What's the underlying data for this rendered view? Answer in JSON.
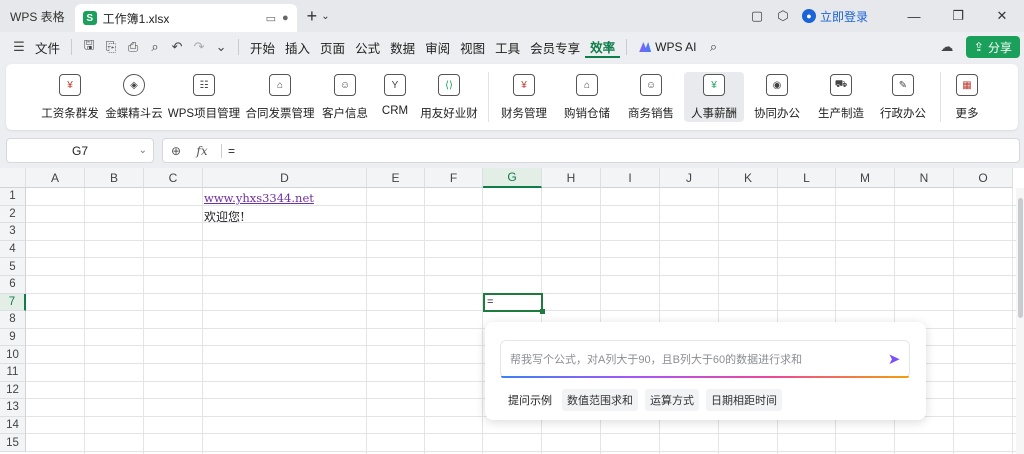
{
  "titlebar": {
    "app_label": "WPS 表格",
    "doc_name": "工作簿1.xlsx",
    "login_label": "立即登录"
  },
  "menu": {
    "file": "文件",
    "tabs": [
      "开始",
      "插入",
      "页面",
      "公式",
      "数据",
      "审阅",
      "视图",
      "工具",
      "会员专享",
      "效率"
    ],
    "active_tab": "效率",
    "ai_label": "WPS AI",
    "share_label": "分享"
  },
  "ribbon": {
    "items": [
      {
        "label": "工资条群发",
        "icon": "salary-icon"
      },
      {
        "label": "金蝶精斗云",
        "icon": "kingdee-icon"
      },
      {
        "label": "WPS项目管理",
        "icon": "project-icon"
      },
      {
        "label": "合同发票管理",
        "icon": "contract-icon"
      },
      {
        "label": "客户信息",
        "icon": "customer-icon"
      },
      {
        "label": "CRM",
        "icon": "crm-icon"
      },
      {
        "label": "用友好业财",
        "icon": "yonyou-icon"
      },
      {
        "label": "财务管理",
        "icon": "finance-icon"
      },
      {
        "label": "购销仓储",
        "icon": "warehouse-icon"
      },
      {
        "label": "商务销售",
        "icon": "sales-icon"
      },
      {
        "label": "人事薪酬",
        "icon": "hr-icon"
      },
      {
        "label": "协同办公",
        "icon": "collab-icon"
      },
      {
        "label": "生产制造",
        "icon": "manufacture-icon"
      },
      {
        "label": "行政办公",
        "icon": "admin-icon"
      },
      {
        "label": "更多",
        "icon": "more-apps-icon"
      }
    ]
  },
  "formula_bar": {
    "cell_ref": "G7",
    "formula": "="
  },
  "sheet": {
    "columns": [
      "A",
      "B",
      "C",
      "D",
      "E",
      "F",
      "G",
      "H",
      "I",
      "J",
      "K",
      "L",
      "M",
      "N",
      "O"
    ],
    "rows": [
      "1",
      "2",
      "3",
      "4",
      "5",
      "6",
      "7",
      "8",
      "9",
      "10",
      "11",
      "12",
      "13",
      "14",
      "15"
    ],
    "d1": "www.yhxs3344.net",
    "d2": "欢迎您!",
    "g7": "="
  },
  "ai_panel": {
    "placeholder": "帮我写个公式，对A列大于90，且B列大于60的数据进行求和",
    "examples_label": "提问示例",
    "examples": [
      "数值范围求和",
      "运算方式",
      "日期相距时间"
    ]
  },
  "colors": {
    "accent": "#0e7d4a",
    "share": "#1aa05a",
    "link": "#7030a0"
  }
}
